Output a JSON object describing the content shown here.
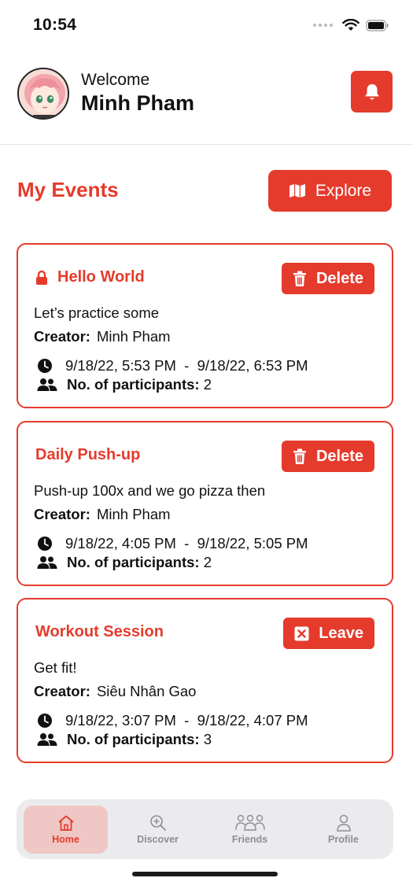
{
  "status_bar": {
    "time": "10:54"
  },
  "header": {
    "welcome": "Welcome",
    "user_name": "Minh Pham"
  },
  "section": {
    "title": "My Events",
    "explore_label": "Explore"
  },
  "events": [
    {
      "title": "Hello World",
      "private": true,
      "action": "Delete",
      "description": "Let’s practice some",
      "creator_label": "Creator:",
      "creator": "Minh Pham",
      "time_range": "9/18/22, 5:53 PM  -  9/18/22, 6:53 PM",
      "participants_label": "No. of participants:",
      "participants": "2"
    },
    {
      "title": "Daily Push-up",
      "private": false,
      "action": "Delete",
      "description": "Push-up 100x and we go pizza then",
      "creator_label": "Creator:",
      "creator": "Minh Pham",
      "time_range": "9/18/22, 4:05 PM  -  9/18/22, 5:05 PM",
      "participants_label": "No. of participants:",
      "participants": "2"
    },
    {
      "title": "Workout Session",
      "private": false,
      "action": "Leave",
      "description": "Get fit!",
      "creator_label": "Creator:",
      "creator": "Siêu Nhân Gao",
      "time_range": "9/18/22, 3:07 PM  -  9/18/22, 4:07 PM",
      "participants_label": "No. of participants:",
      "participants": "3"
    }
  ],
  "tabs": [
    {
      "label": "Home",
      "icon": "home-icon",
      "active": true
    },
    {
      "label": "Discover",
      "icon": "discover-icon",
      "active": false
    },
    {
      "label": "Friends",
      "icon": "friends-icon",
      "active": false
    },
    {
      "label": "Profile",
      "icon": "profile-icon",
      "active": false
    }
  ],
  "colors": {
    "accent": "#e53b2c",
    "tab_active_bg": "#efc7c4",
    "tab_bar_bg": "#ebebed"
  }
}
